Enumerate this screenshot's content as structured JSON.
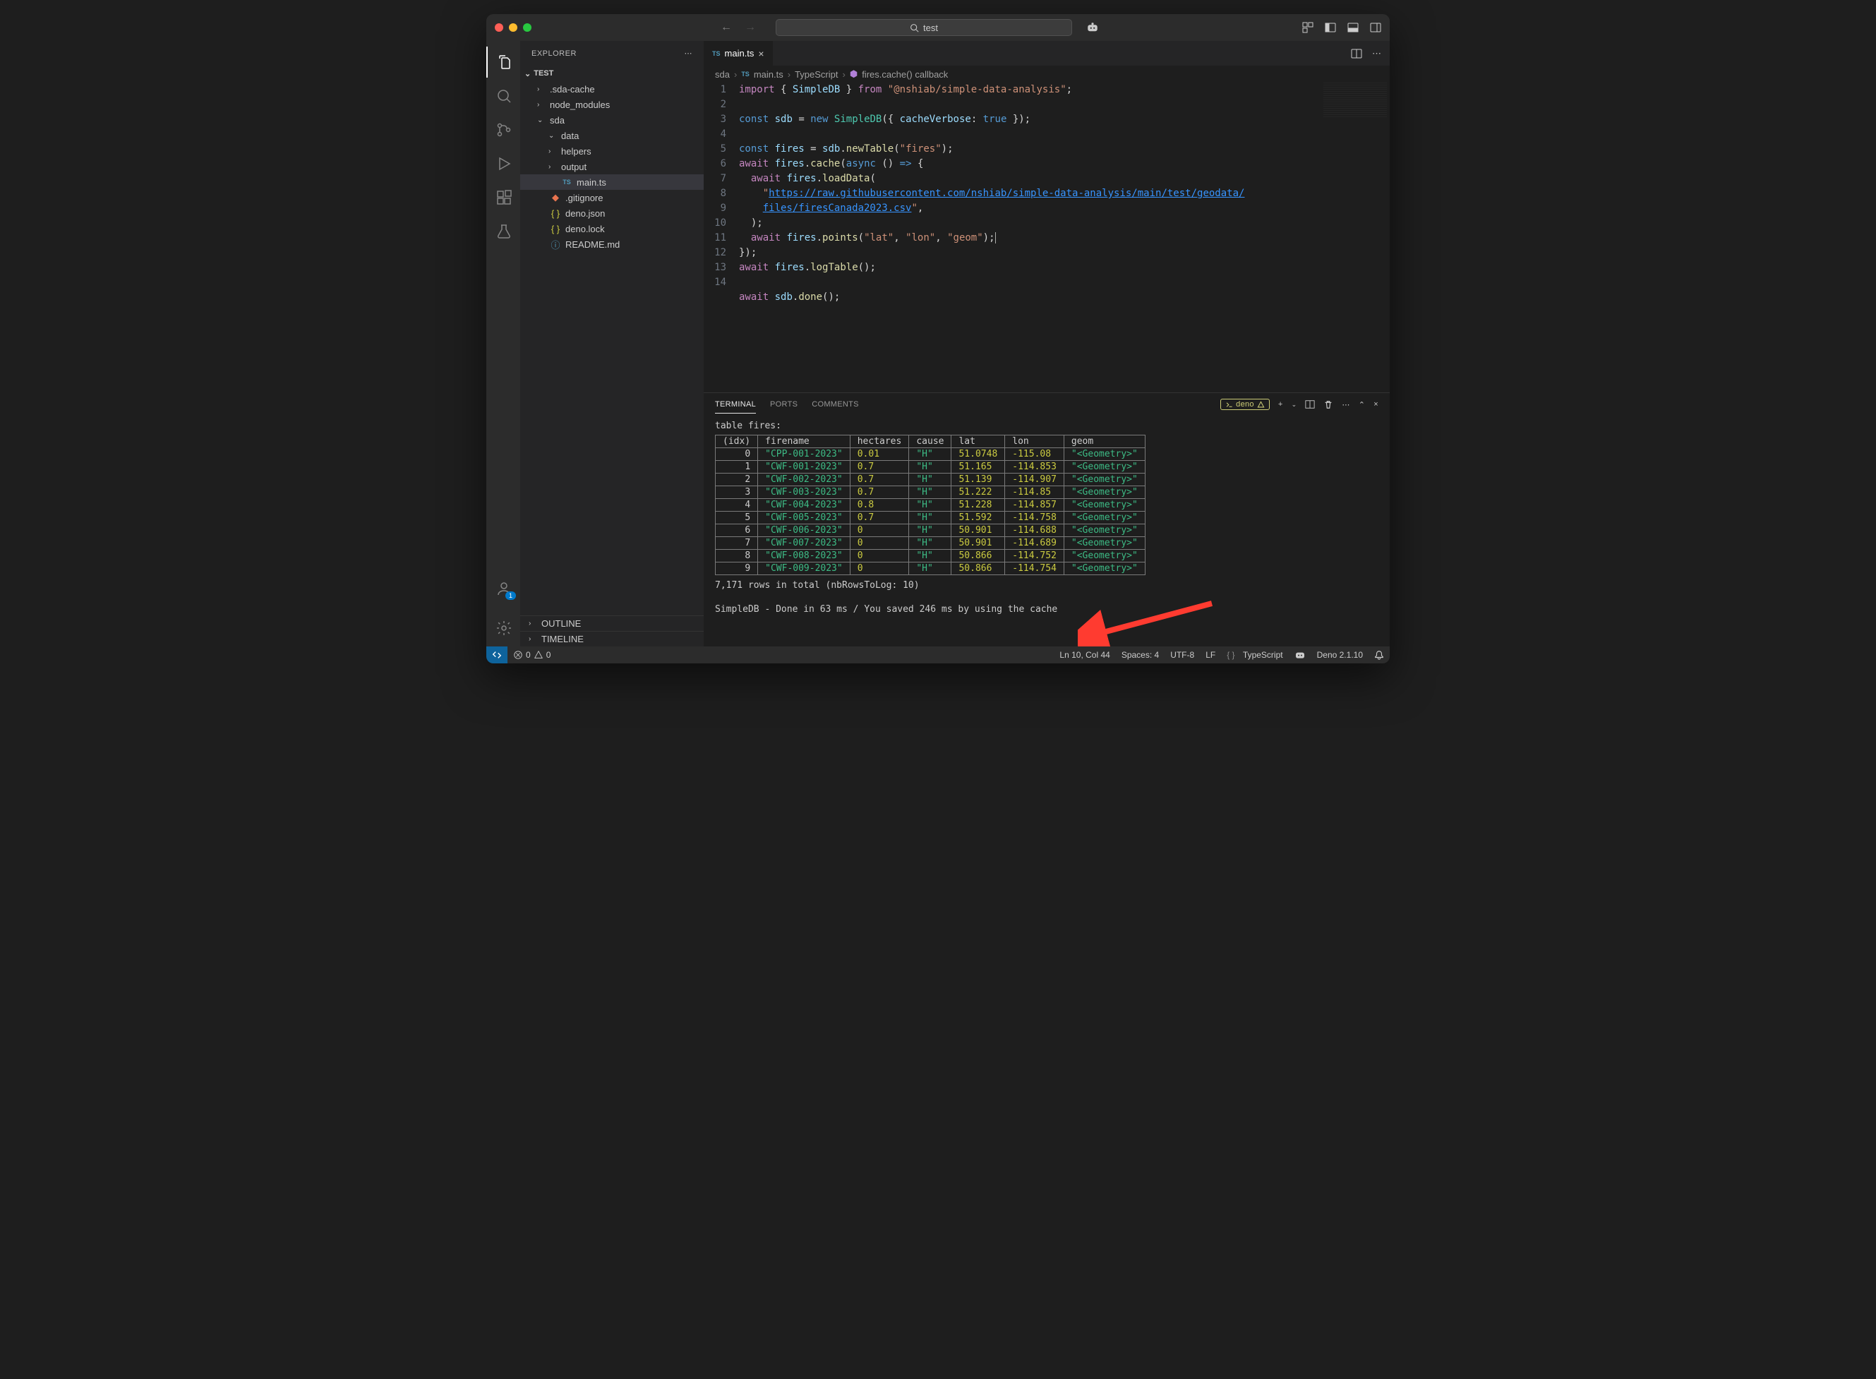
{
  "titlebar": {
    "search_text": "test"
  },
  "sidebar": {
    "title": "EXPLORER",
    "root": "TEST",
    "tree": [
      {
        "label": ".sda-cache",
        "type": "folder",
        "depth": 1,
        "expanded": false
      },
      {
        "label": "node_modules",
        "type": "folder",
        "depth": 1,
        "expanded": false
      },
      {
        "label": "sda",
        "type": "folder",
        "depth": 1,
        "expanded": true
      },
      {
        "label": "data",
        "type": "folder",
        "depth": 2,
        "expanded": true
      },
      {
        "label": "helpers",
        "type": "folder",
        "depth": 2,
        "expanded": false
      },
      {
        "label": "output",
        "type": "folder",
        "depth": 2,
        "expanded": false
      },
      {
        "label": "main.ts",
        "type": "ts",
        "depth": 2,
        "selected": true
      },
      {
        "label": ".gitignore",
        "type": "git",
        "depth": 1
      },
      {
        "label": "deno.json",
        "type": "json",
        "depth": 1
      },
      {
        "label": "deno.lock",
        "type": "json",
        "depth": 1
      },
      {
        "label": "README.md",
        "type": "info",
        "depth": 1
      }
    ],
    "outline": "OUTLINE",
    "timeline": "TIMELINE"
  },
  "tab": {
    "label": "main.ts",
    "icon": "TS"
  },
  "breadcrumb": {
    "parts": [
      "sda",
      "main.ts",
      "TypeScript",
      "fires.cache() callback"
    ]
  },
  "code": {
    "lines": [
      [
        {
          "t": "import",
          "c": "kw"
        },
        {
          "t": " { ",
          "c": "pun"
        },
        {
          "t": "SimpleDB",
          "c": "var"
        },
        {
          "t": " } ",
          "c": "pun"
        },
        {
          "t": "from",
          "c": "kw"
        },
        {
          "t": " ",
          "c": "pun"
        },
        {
          "t": "\"@nshiab/simple-data-analysis\"",
          "c": "str"
        },
        {
          "t": ";",
          "c": "pun"
        }
      ],
      [],
      [
        {
          "t": "const",
          "c": "kw2"
        },
        {
          "t": " ",
          "c": ""
        },
        {
          "t": "sdb",
          "c": "var"
        },
        {
          "t": " = ",
          "c": "pun"
        },
        {
          "t": "new",
          "c": "kw2"
        },
        {
          "t": " ",
          "c": ""
        },
        {
          "t": "SimpleDB",
          "c": "cls"
        },
        {
          "t": "({ ",
          "c": "pun"
        },
        {
          "t": "cacheVerbose",
          "c": "var"
        },
        {
          "t": ": ",
          "c": "pun"
        },
        {
          "t": "true",
          "c": "kw2"
        },
        {
          "t": " });",
          "c": "pun"
        }
      ],
      [],
      [
        {
          "t": "const",
          "c": "kw2"
        },
        {
          "t": " ",
          "c": ""
        },
        {
          "t": "fires",
          "c": "var"
        },
        {
          "t": " = ",
          "c": "pun"
        },
        {
          "t": "sdb",
          "c": "var"
        },
        {
          "t": ".",
          "c": "pun"
        },
        {
          "t": "newTable",
          "c": "fn"
        },
        {
          "t": "(",
          "c": "pun"
        },
        {
          "t": "\"fires\"",
          "c": "str"
        },
        {
          "t": ");",
          "c": "pun"
        }
      ],
      [
        {
          "t": "await",
          "c": "kw"
        },
        {
          "t": " ",
          "c": ""
        },
        {
          "t": "fires",
          "c": "var"
        },
        {
          "t": ".",
          "c": "pun"
        },
        {
          "t": "cache",
          "c": "fn"
        },
        {
          "t": "(",
          "c": "pun"
        },
        {
          "t": "async",
          "c": "kw2"
        },
        {
          "t": " () ",
          "c": "pun"
        },
        {
          "t": "=>",
          "c": "kw2"
        },
        {
          "t": " {",
          "c": "pun"
        }
      ],
      [
        {
          "t": "  ",
          "c": ""
        },
        {
          "t": "await",
          "c": "kw"
        },
        {
          "t": " ",
          "c": ""
        },
        {
          "t": "fires",
          "c": "var"
        },
        {
          "t": ".",
          "c": "pun"
        },
        {
          "t": "loadData",
          "c": "fn"
        },
        {
          "t": "(",
          "c": "pun"
        }
      ],
      [
        {
          "t": "    ",
          "c": ""
        },
        {
          "t": "\"",
          "c": "str"
        },
        {
          "t": "https://raw.githubusercontent.com/nshiab/simple-data-analysis/main/test/geodata/",
          "c": "url"
        }
      ],
      [
        {
          "t": "    ",
          "c": ""
        },
        {
          "t": "files/firesCanada2023.csv",
          "c": "url"
        },
        {
          "t": "\"",
          "c": "str"
        },
        {
          "t": ",",
          "c": "pun"
        }
      ],
      [
        {
          "t": "  );",
          "c": "pun"
        }
      ],
      [
        {
          "t": "  ",
          "c": ""
        },
        {
          "t": "await",
          "c": "kw"
        },
        {
          "t": " ",
          "c": ""
        },
        {
          "t": "fires",
          "c": "var"
        },
        {
          "t": ".",
          "c": "pun"
        },
        {
          "t": "points",
          "c": "fn"
        },
        {
          "t": "(",
          "c": "pun"
        },
        {
          "t": "\"lat\"",
          "c": "str"
        },
        {
          "t": ", ",
          "c": "pun"
        },
        {
          "t": "\"lon\"",
          "c": "str"
        },
        {
          "t": ", ",
          "c": "pun"
        },
        {
          "t": "\"geom\"",
          "c": "str"
        },
        {
          "t": ");",
          "c": "pun"
        },
        {
          "t": "CURSOR",
          "c": "cursor"
        }
      ],
      [
        {
          "t": "});",
          "c": "pun"
        }
      ],
      [
        {
          "t": "await",
          "c": "kw"
        },
        {
          "t": " ",
          "c": ""
        },
        {
          "t": "fires",
          "c": "var"
        },
        {
          "t": ".",
          "c": "pun"
        },
        {
          "t": "logTable",
          "c": "fn"
        },
        {
          "t": "();",
          "c": "pun"
        }
      ],
      [],
      [
        {
          "t": "await",
          "c": "kw"
        },
        {
          "t": " ",
          "c": ""
        },
        {
          "t": "sdb",
          "c": "var"
        },
        {
          "t": ".",
          "c": "pun"
        },
        {
          "t": "done",
          "c": "fn"
        },
        {
          "t": "();",
          "c": "pun"
        }
      ]
    ],
    "line_offset": 1,
    "line8_combined": true
  },
  "panel": {
    "tabs": [
      "TERMINAL",
      "PORTS",
      "COMMENTS"
    ],
    "active_tab": "TERMINAL",
    "term_name": "deno",
    "title_line": "table fires:",
    "columns": [
      "(idx)",
      "firename",
      "hectares",
      "cause",
      "lat",
      "lon",
      "geom"
    ],
    "rows": [
      [
        "0",
        "\"CPP-001-2023\"",
        "0.01",
        "\"H\"",
        "51.0748",
        "-115.08",
        "\"<Geometry>\""
      ],
      [
        "1",
        "\"CWF-001-2023\"",
        "0.7",
        "\"H\"",
        "51.165",
        "-114.853",
        "\"<Geometry>\""
      ],
      [
        "2",
        "\"CWF-002-2023\"",
        "0.7",
        "\"H\"",
        "51.139",
        "-114.907",
        "\"<Geometry>\""
      ],
      [
        "3",
        "\"CWF-003-2023\"",
        "0.7",
        "\"H\"",
        "51.222",
        "-114.85",
        "\"<Geometry>\""
      ],
      [
        "4",
        "\"CWF-004-2023\"",
        "0.8",
        "\"H\"",
        "51.228",
        "-114.857",
        "\"<Geometry>\""
      ],
      [
        "5",
        "\"CWF-005-2023\"",
        "0.7",
        "\"H\"",
        "51.592",
        "-114.758",
        "\"<Geometry>\""
      ],
      [
        "6",
        "\"CWF-006-2023\"",
        "0",
        "\"H\"",
        "50.901",
        "-114.688",
        "\"<Geometry>\""
      ],
      [
        "7",
        "\"CWF-007-2023\"",
        "0",
        "\"H\"",
        "50.901",
        "-114.689",
        "\"<Geometry>\""
      ],
      [
        "8",
        "\"CWF-008-2023\"",
        "0",
        "\"H\"",
        "50.866",
        "-114.752",
        "\"<Geometry>\""
      ],
      [
        "9",
        "\"CWF-009-2023\"",
        "0",
        "\"H\"",
        "50.866",
        "-114.754",
        "\"<Geometry>\""
      ]
    ],
    "footer1": "7,171 rows in total (nbRowsToLog: 10)",
    "footer2": "SimpleDB - Done in 63 ms / You saved 246 ms by using the cache"
  },
  "statusbar": {
    "errors": "0",
    "warnings": "0",
    "cursor": "Ln 10, Col 44",
    "spaces": "Spaces: 4",
    "encoding": "UTF-8",
    "eol": "LF",
    "lang": "TypeScript",
    "deno": "Deno 2.1.10"
  }
}
